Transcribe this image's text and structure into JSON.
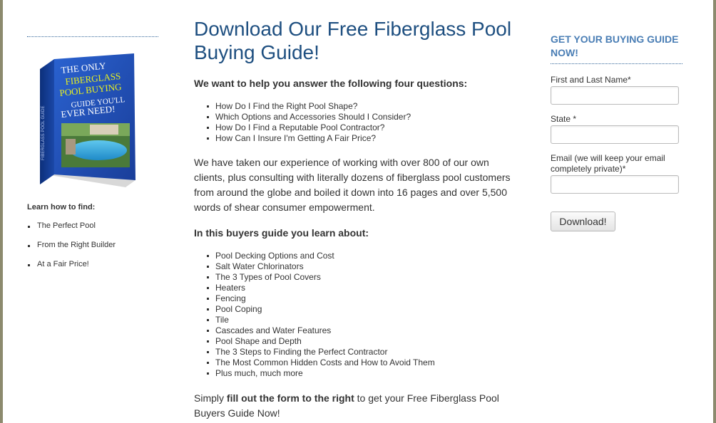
{
  "left": {
    "book_cover": {
      "title_lines": [
        "THE ONLY",
        "FIBERGLASS",
        "POOL BUYING",
        "GUIDE YOU'LL",
        "EVER NEED!"
      ],
      "colors": {
        "cover": "#1f4fb0",
        "accent_text": "#e8f020",
        "text": "#ffffff"
      }
    },
    "learn_title": "Learn how to find:",
    "learn_items": [
      "The Perfect Pool",
      "From the Right Builder",
      "At a Fair Price!"
    ]
  },
  "main": {
    "heading": "Download Our Free Fiberglass Pool Buying Guide!",
    "intro": "We want to help you answer the following four questions:",
    "questions": [
      "How Do I Find the Right Pool Shape?",
      "Which Options and Accessories Should I Consider?",
      "How Do I Find a Reputable Pool Contractor?",
      "How Can I Insure I'm Getting A Fair Price?"
    ],
    "paragraph": "We have taken our experience of working with over 800 of our own clients, plus consulting with literally dozens of fiberglass pool customers from around the globe and boiled it down into 16 pages and over 5,500 words of shear consumer empowerment.",
    "learn_about": "In this buyers guide you learn about:",
    "guide_topics": [
      "Pool Decking Options and Cost",
      "Salt Water Chlorinators",
      "The 3 Types of Pool Covers",
      "Heaters",
      "Fencing",
      "Pool Coping",
      "Tile",
      "Cascades and Water Features",
      "Pool Shape and Depth",
      "The 3 Steps to Finding the Perfect Contractor",
      "The Most Common Hidden Costs and How to Avoid Them",
      "Plus much, much more"
    ],
    "closing": {
      "prefix": "Simply ",
      "bold": "fill out the form to the right",
      "suffix": " to get your Free Fiberglass Pool Buyers Guide Now!"
    }
  },
  "form": {
    "title": "GET YOUR BUYING GUIDE NOW!",
    "name_label": "First and Last Name*",
    "name_value": "",
    "state_label": "State *",
    "state_value": "",
    "email_label": "Email (we will keep your email completely private)*",
    "email_value": "",
    "button_label": "Download!"
  },
  "colors": {
    "heading": "#1e4f80",
    "form_title": "#4a7eb5",
    "rule": "#33669a",
    "frame": "#8c8a6e"
  }
}
